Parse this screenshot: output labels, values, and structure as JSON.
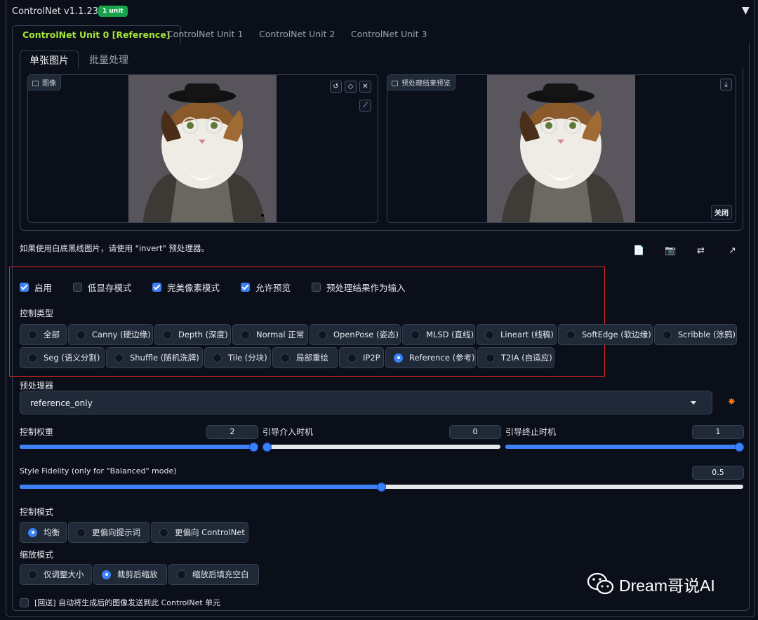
{
  "header": {
    "title": "ControlNet v1.1.238",
    "badge": "1 unit"
  },
  "unit_tabs": [
    "ControlNet Unit 0 [Reference]",
    "ControlNet Unit 1",
    "ControlNet Unit 2",
    "ControlNet Unit 3"
  ],
  "sub_tabs": [
    "单张图片",
    "批量处理"
  ],
  "image_panel": {
    "label": "图像"
  },
  "preview_panel": {
    "label": "预处理结果预览",
    "close_label": "关闭"
  },
  "hint_text": "如果使用白底黑线图片，请使用 \"invert\" 预处理器。",
  "checkboxes": [
    {
      "label": "启用",
      "checked": true
    },
    {
      "label": "低显存模式",
      "checked": false
    },
    {
      "label": "完美像素模式",
      "checked": true
    },
    {
      "label": "允许预览",
      "checked": true
    },
    {
      "label": "预处理结果作为输入",
      "checked": false
    }
  ],
  "control_type": {
    "label": "控制类型",
    "options": [
      "全部",
      "Canny (硬边缘)",
      "Depth (深度)",
      "Normal 正常",
      "OpenPose (姿态)",
      "MLSD (直线)",
      "Lineart (线稿)",
      "SoftEdge (软边缘)",
      "Scribble (涂鸦)",
      "Seg (语义分割)",
      "Shuffle (随机洗牌)",
      "Tile (分块)",
      "局部重绘",
      "IP2P",
      "Reference (参考)",
      "T2IA (自适应)"
    ],
    "selected": "Reference (参考)"
  },
  "preprocessor": {
    "label": "预处理器",
    "value": "reference_only"
  },
  "sliders": {
    "weight": {
      "label": "控制权重",
      "value": "2",
      "fraction": 1.0
    },
    "start": {
      "label": "引导介入时机",
      "value": "0",
      "fraction": 0.0
    },
    "end": {
      "label": "引导终止时机",
      "value": "1",
      "fraction": 1.0
    },
    "fidelity": {
      "label": "Style Fidelity (only for \"Balanced\" mode)",
      "value": "0.5",
      "fraction": 0.5
    }
  },
  "control_mode": {
    "label": "控制模式",
    "options": [
      "均衡",
      "更偏向提示词",
      "更偏向 ControlNet"
    ],
    "selected": "均衡"
  },
  "resize_mode": {
    "label": "缩放模式",
    "options": [
      "仅调整大小",
      "裁剪后缩放",
      "缩放后填充空白"
    ],
    "selected": "裁剪后缩放"
  },
  "loopback": {
    "label": "[回送] 自动将生成后的图像发送到此 ControlNet 单元",
    "checked": false
  },
  "watermark": "Dream哥说AI",
  "colors": {
    "accent": "#3b82f6",
    "active_tab": "#a3e635",
    "badge": "#16a34a",
    "highlight_box": "#dc2626"
  }
}
